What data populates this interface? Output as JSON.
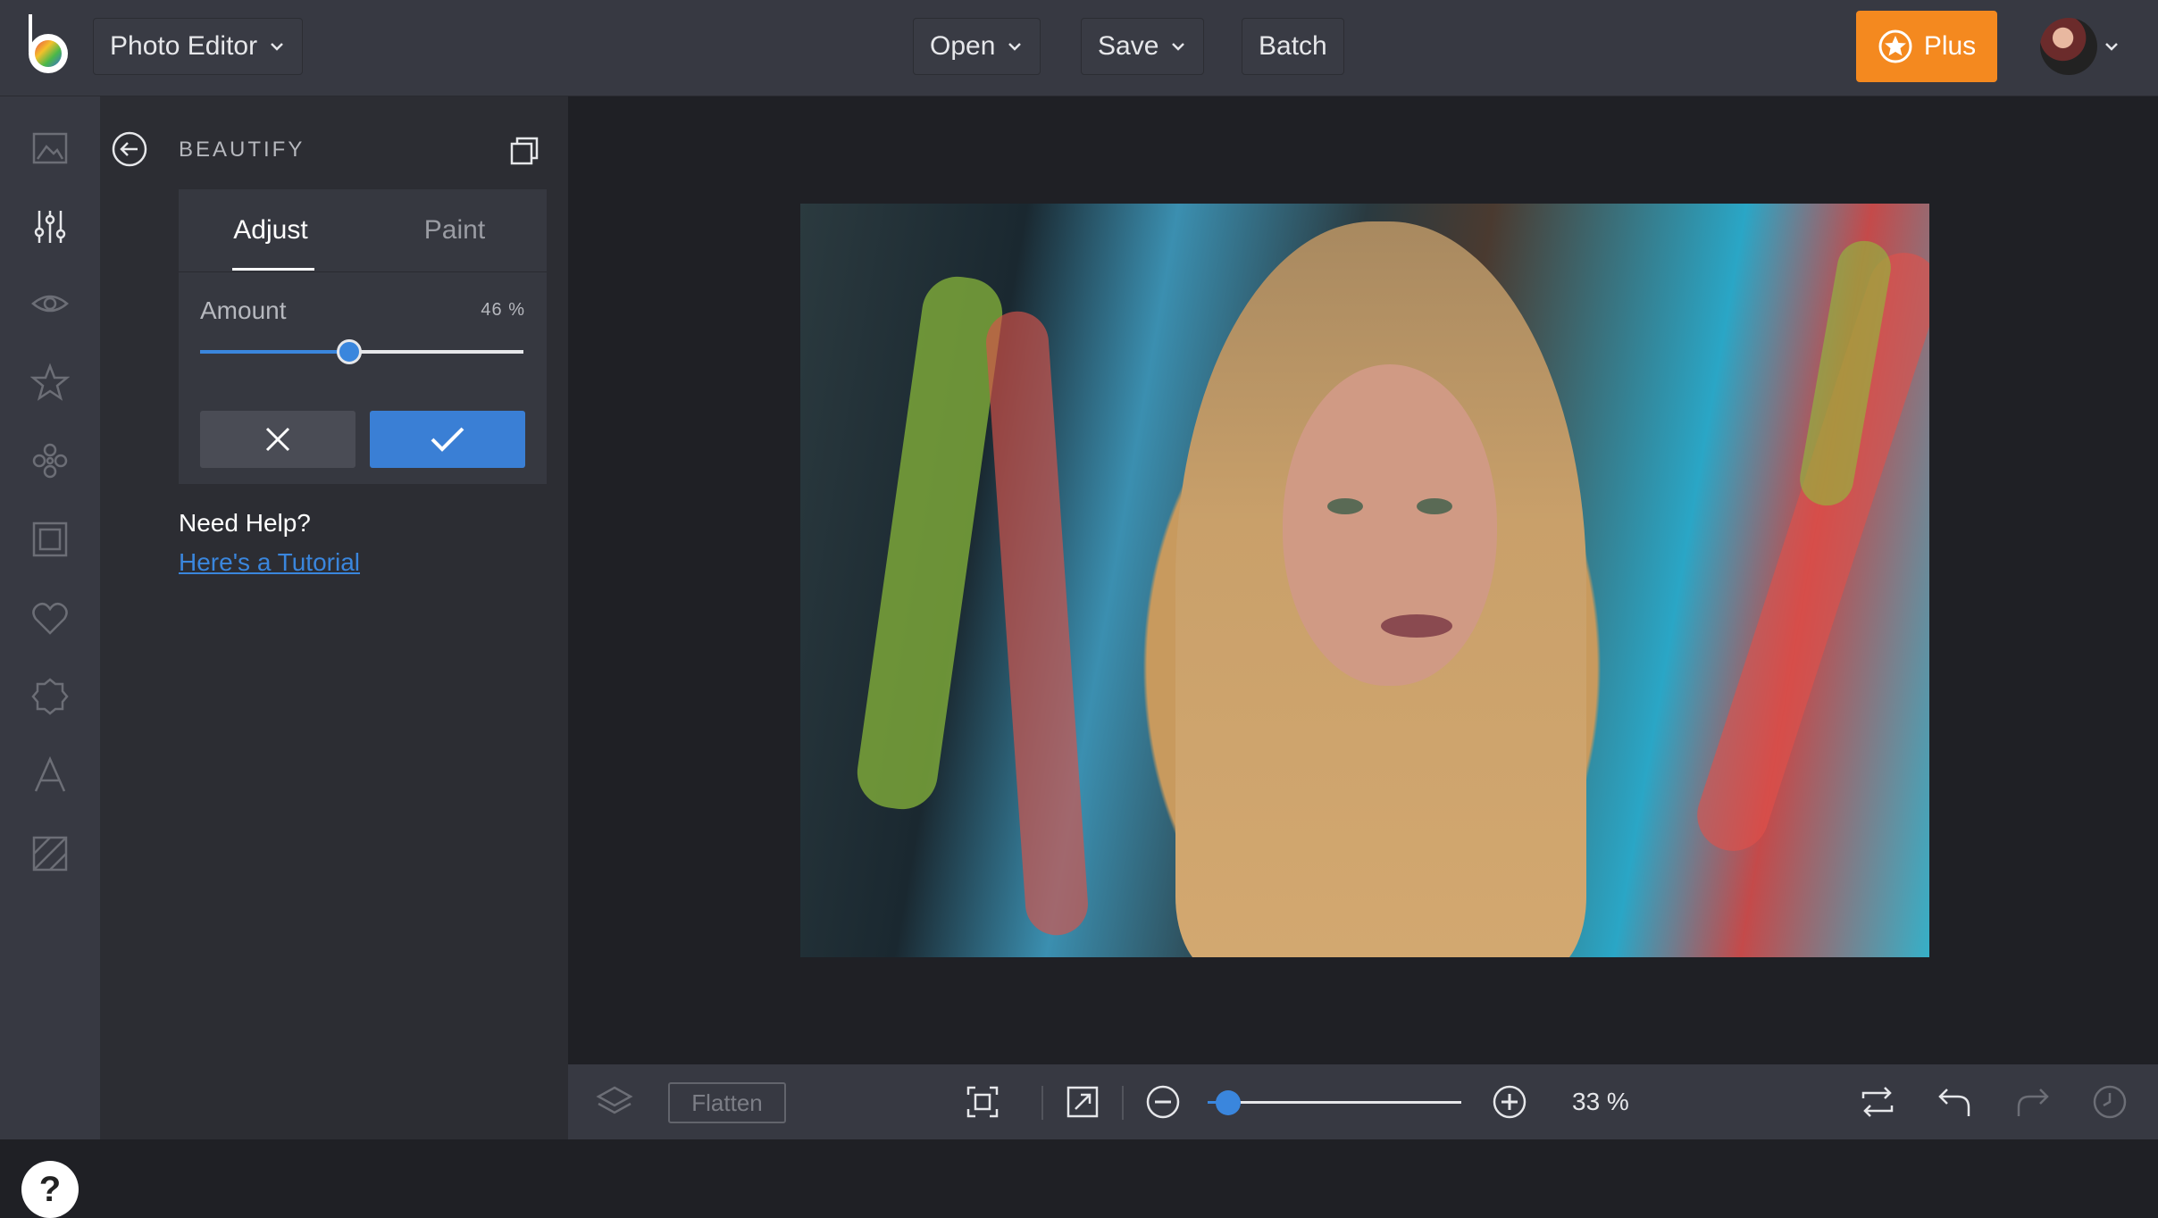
{
  "header": {
    "app_menu_label": "Photo Editor",
    "open_label": "Open",
    "save_label": "Save",
    "batch_label": "Batch",
    "plus_label": "Plus"
  },
  "sidebar": {
    "icons": [
      "photo-icon",
      "adjust-sliders-icon",
      "eye-icon",
      "star-icon",
      "flower-icon",
      "frame-icon",
      "heart-icon",
      "badge-icon",
      "text-icon",
      "texture-icon"
    ],
    "help_label": "?"
  },
  "panel": {
    "title": "BEAUTIFY",
    "tabs": [
      {
        "label": "Adjust"
      },
      {
        "label": "Paint"
      }
    ],
    "amount_label": "Amount",
    "amount_value": 46,
    "amount_value_text": "46 %",
    "help_title": "Need Help?",
    "help_link": "Here's a Tutorial"
  },
  "bottom": {
    "flatten_label": "Flatten",
    "zoom_value": 33,
    "zoom_text": "33 %"
  },
  "colors": {
    "accent": "#3a86dd",
    "plus": "#f4891f"
  }
}
